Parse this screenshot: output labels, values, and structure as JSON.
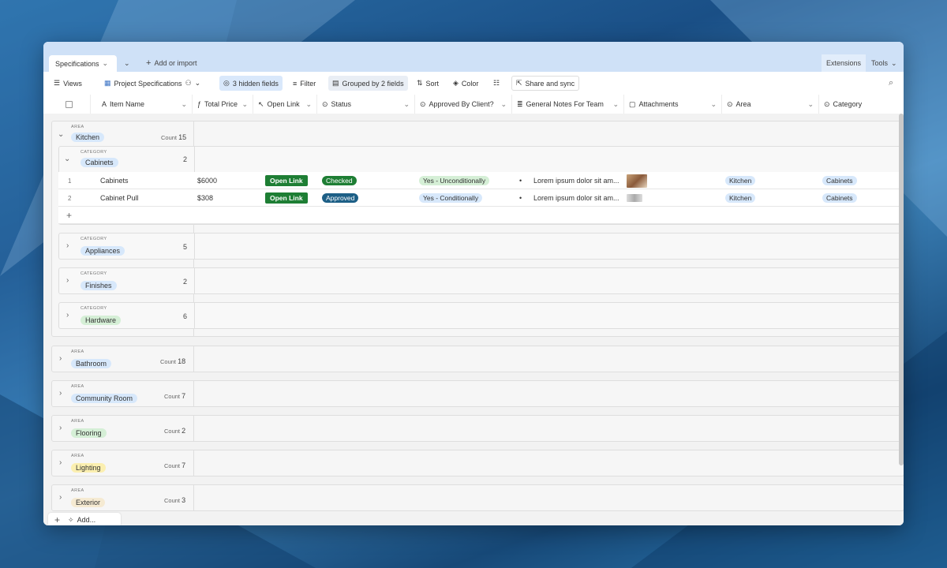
{
  "tabs": {
    "active": "Specifications",
    "add_label": "Add or import",
    "extensions": "Extensions",
    "tools": "Tools"
  },
  "toolbar": {
    "views": "Views",
    "view_name": "Project Specifications",
    "hidden_fields": "3 hidden fields",
    "filter": "Filter",
    "grouped": "Grouped by 2 fields",
    "sort": "Sort",
    "color": "Color",
    "share": "Share and sync"
  },
  "columns": [
    "Item Name",
    "Total Price",
    "Open Link",
    "Status",
    "Approved By Client?",
    "General Notes For Team",
    "Attachments",
    "Area",
    "Category"
  ],
  "captions": {
    "area": "AREA",
    "category": "CATEGORY",
    "count": "Count"
  },
  "groups": [
    {
      "name": "Kitchen",
      "count": "15",
      "color": "#d7e8fb"
    },
    {
      "name": "Bathroom",
      "count": "18",
      "color": "#d7e8fb"
    },
    {
      "name": "Community Room",
      "count": "7",
      "color": "#d7e8fb"
    },
    {
      "name": "Flooring",
      "count": "2",
      "color": "#d5efd6"
    },
    {
      "name": "Lighting",
      "count": "7",
      "color": "#fbefb0"
    },
    {
      "name": "Exterior",
      "count": "3",
      "color": "#f5ead2"
    }
  ],
  "subgroups": [
    {
      "name": "Cabinets",
      "count": "2",
      "color": "#d7e8fb"
    },
    {
      "name": "Appliances",
      "count": "5",
      "color": "#d7e8fb"
    },
    {
      "name": "Finishes",
      "count": "2",
      "color": "#d7e8fb"
    },
    {
      "name": "Hardware",
      "count": "6",
      "color": "#d5efd6"
    }
  ],
  "rows": [
    {
      "num": "1",
      "item": "Cabinets",
      "price": "$6000",
      "link": "Open Link",
      "status": "Checked",
      "status_color": "#1e7e34",
      "approved": "Yes - Unconditionally",
      "approved_color": "#d5efd6",
      "notes": "Lorem ipsum dolor sit am...",
      "area": "Kitchen",
      "category": "Cabinets"
    },
    {
      "num": "2",
      "item": "Cabinet Pull",
      "price": "$308",
      "link": "Open Link",
      "status": "Approved",
      "status_color": "#1d5f86",
      "approved": "Yes - Conditionally",
      "approved_color": "#d7e8fb",
      "notes": "Lorem ipsum dolor sit am...",
      "area": "Kitchen",
      "category": "Cabinets"
    }
  ],
  "footer": {
    "add": "Add..."
  },
  "colors": {
    "accent": "#1e7e34",
    "tabbar": "#cfe1f7"
  }
}
